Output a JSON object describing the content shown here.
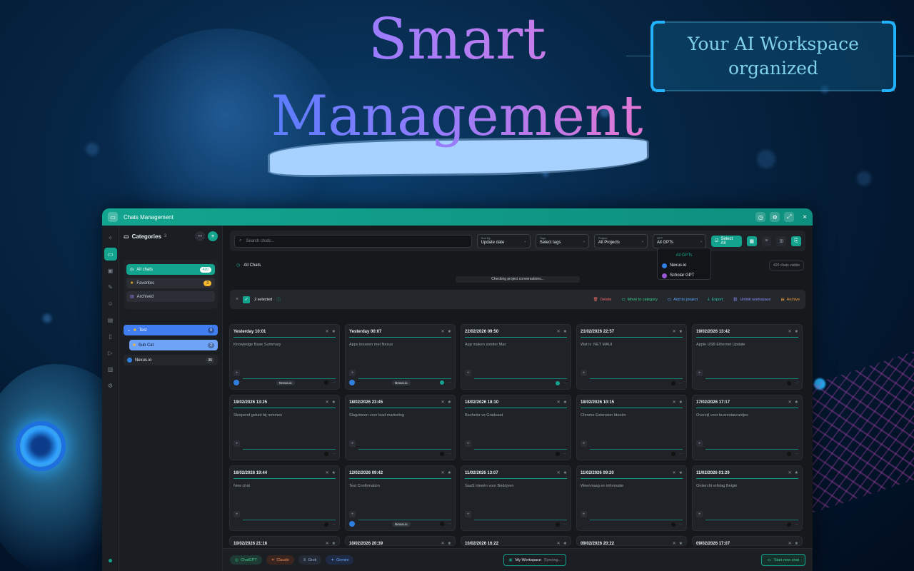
{
  "hero": {
    "title_line1": "Smart",
    "title_line2": "Management",
    "callout_line1": "Your AI Workspace",
    "callout_line2": "organized"
  },
  "window": {
    "title": "Chats Management"
  },
  "sidebar": {
    "heading": "Categories",
    "heading_count": "3",
    "items": [
      {
        "label": "All chats",
        "badge": "420"
      },
      {
        "label": "Favorites",
        "badge": "3"
      },
      {
        "label": "Archived",
        "badge": ""
      }
    ],
    "folders": [
      {
        "label": "Test",
        "badge": "0"
      },
      {
        "label": "Sub Cat",
        "badge": "2"
      },
      {
        "label": "Nexus.io",
        "badge": "36"
      }
    ]
  },
  "toolbar": {
    "search_placeholder": "Search chats...",
    "sort_label": "Sort By",
    "sort_value": "Update date",
    "tags_label": "Tags",
    "tags_value": "Select tags",
    "project_label": "Project",
    "project_value": "All Projects",
    "gpt_label": "GPT",
    "gpt_value": "All GPTs",
    "select_all": "Select All"
  },
  "gpt_dropdown": {
    "options": [
      "All GPTs",
      "Nexus.io",
      "Scholar GPT"
    ]
  },
  "main": {
    "section_title": "All Chats",
    "visible_count": "420 chats visible",
    "checking_text": "Checking project conversations..."
  },
  "selection": {
    "selected_text": "2 selected",
    "actions": [
      "Delete",
      "Move to category",
      "Add to project",
      "Export",
      "Unlink workspace",
      "Archive"
    ]
  },
  "cards": [
    {
      "date": "Yesterday 10:01",
      "title": "Knowledge Base Summary",
      "tag": "Nexus.io",
      "checked": false
    },
    {
      "date": "Yesterday 00:07",
      "title": "Apps bouwen met Nexus",
      "tag": "Nexus.io",
      "checked": true
    },
    {
      "date": "22/02/2026 09:50",
      "title": "App maken zonder Mac",
      "tag": "",
      "checked": true
    },
    {
      "date": "21/02/2026 22:57",
      "title": "Wat is .NET MAUI",
      "tag": "",
      "checked": false
    },
    {
      "date": "19/02/2026 13:42",
      "title": "Apple USB Ethernet Update",
      "tag": "",
      "checked": false
    },
    {
      "date": "19/02/2026 13:25",
      "title": "Sleepend geluid bij remmen",
      "tag": "",
      "checked": false
    },
    {
      "date": "18/02/2026 23:45",
      "title": "Slagzinnen voor lead marketing",
      "tag": "",
      "checked": false
    },
    {
      "date": "18/02/2026 18:10",
      "title": "Bachelor vs Graduaat",
      "tag": "",
      "checked": false
    },
    {
      "date": "18/02/2026 10:15",
      "title": "Chrome Extension Ideeën",
      "tag": "",
      "checked": false
    },
    {
      "date": "17/02/2026 17:17",
      "title": "Overzijl voor busrestaurantjes",
      "tag": "",
      "checked": false
    },
    {
      "date": "16/02/2026 19:44",
      "title": "New chat",
      "tag": "",
      "checked": false
    },
    {
      "date": "12/02/2026 09:42",
      "title": "Test Confirmation",
      "tag": "Nexus.io",
      "checked": false
    },
    {
      "date": "11/02/2026 13:07",
      "title": "SaaS Ideeën voor Bedrijven",
      "tag": "",
      "checked": false
    },
    {
      "date": "11/02/2026 09:20",
      "title": "Weervraag en informatie",
      "tag": "",
      "checked": false
    },
    {
      "date": "11/02/2026 01:29",
      "title": "Ontiercht erfslag België",
      "tag": "",
      "checked": false
    },
    {
      "date": "10/02/2026 21:16",
      "title": "",
      "tag": "",
      "checked": false
    },
    {
      "date": "10/02/2026 20:39",
      "title": "",
      "tag": "",
      "checked": false
    },
    {
      "date": "10/02/2026 16:22",
      "title": "",
      "tag": "",
      "checked": false
    },
    {
      "date": "09/02/2026 20:22",
      "title": "",
      "tag": "",
      "checked": false
    },
    {
      "date": "09/02/2026 17:07",
      "title": "",
      "tag": "",
      "checked": false
    }
  ],
  "footer": {
    "providers": [
      "ChatGPT",
      "Claude",
      "Grok",
      "Gemini"
    ],
    "workspace": "My Workspace",
    "sync": "Syncing...",
    "new_chat": "Start new chat"
  },
  "colors": {
    "accent": "#14a38e",
    "folder_blue": "#3f7df0",
    "folder_lightblue": "#6fa3f7"
  }
}
